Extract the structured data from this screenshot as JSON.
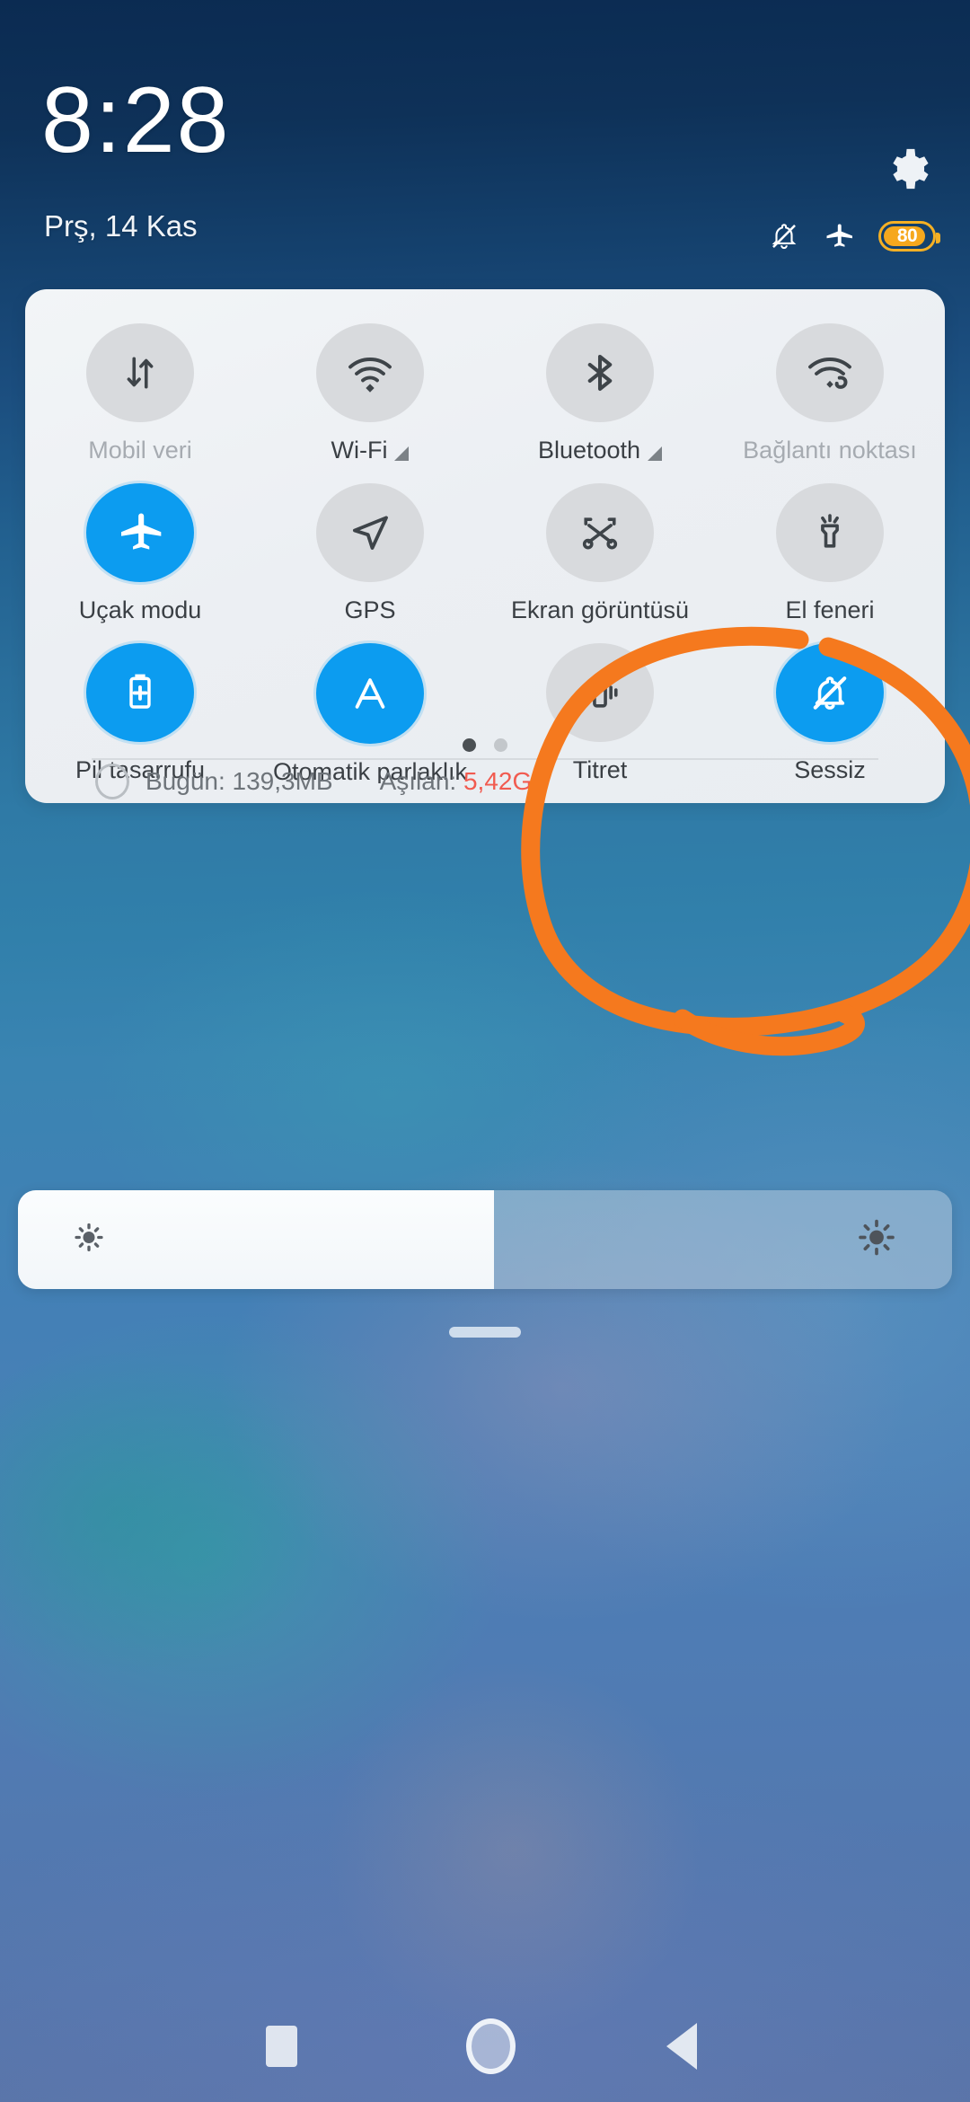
{
  "statusbar": {
    "time": "8:28",
    "date": "Prş, 14 Kas",
    "gear_icon": "gear-icon",
    "icons": [
      {
        "name": "bell-muted-icon"
      },
      {
        "name": "airplane-mode-icon"
      }
    ],
    "battery": {
      "level_text": "80",
      "level_percent": 80,
      "color": "#f6a81d"
    }
  },
  "quick_settings": {
    "rows": [
      [
        {
          "label": "Mobil veri",
          "icon": "mobile-data-icon",
          "state": "disabled",
          "expandable": false
        },
        {
          "label": "Wi-Fi",
          "icon": "wifi-icon",
          "state": "off",
          "expandable": true
        },
        {
          "label": "Bluetooth",
          "icon": "bluetooth-icon",
          "state": "off",
          "expandable": true
        },
        {
          "label": "Bağlantı noktası",
          "icon": "hotspot-icon",
          "state": "disabled",
          "expandable": false
        }
      ],
      [
        {
          "label": "Uçak modu",
          "icon": "airplane-icon",
          "state": "on",
          "expandable": false
        },
        {
          "label": "GPS",
          "icon": "location-arrow-icon",
          "state": "off",
          "expandable": false
        },
        {
          "label": "Ekran görüntüsü",
          "icon": "screenshot-scissors-icon",
          "state": "off",
          "expandable": false
        },
        {
          "label": "El feneri",
          "icon": "flashlight-icon",
          "state": "off",
          "expandable": false
        }
      ],
      [
        {
          "label": "Pil tasarrufu",
          "icon": "battery-saver-icon",
          "state": "on",
          "expandable": false
        },
        {
          "label": "Otomatik parlaklık",
          "icon": "auto-brightness-a-icon",
          "state": "on",
          "expandable": false
        },
        {
          "label": "Titret",
          "icon": "vibrate-icon",
          "state": "off",
          "expandable": false
        },
        {
          "label": "Sessiz",
          "icon": "silent-bell-icon",
          "state": "on",
          "expandable": false
        }
      ]
    ],
    "pages": {
      "count": 2,
      "active_index": 0
    },
    "data_usage": {
      "today_label": "Bugün: 139,3MB",
      "exceeded_label": "Aşılan:",
      "exceeded_value": "5,42GB",
      "exceeded_color": "#f15b50"
    },
    "accent_on_color": "#0c9cf0",
    "tile_off_color": "#d8dadd"
  },
  "brightness": {
    "value_percent": 51,
    "low_icon": "brightness-low-icon",
    "high_icon": "brightness-high-icon"
  },
  "annotation": {
    "shape": "hand-drawn-circle",
    "color": "#f5791e",
    "encircles": "Titret ve Sessiz"
  },
  "navbar": {
    "recents": "recents-square-icon",
    "home": "home-circle-icon",
    "back": "back-triangle-icon"
  }
}
